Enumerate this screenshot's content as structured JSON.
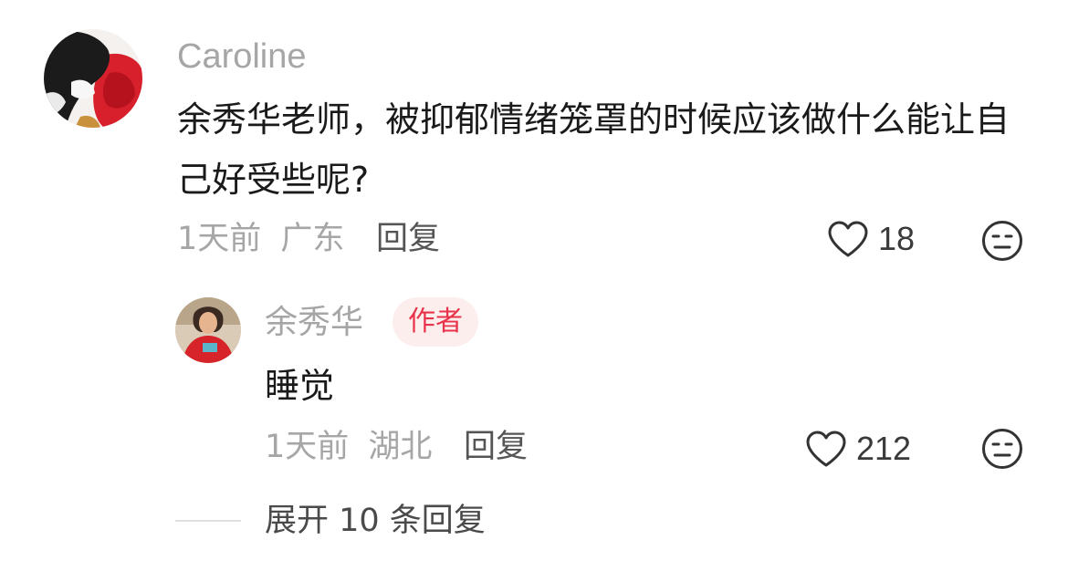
{
  "comment": {
    "author": "Caroline",
    "text": "余秀华老师，被抑郁情绪笼罩的时候应该做什么能让自己好受些呢?",
    "time": "1天前",
    "location": "广东",
    "reply_label": "回复",
    "likes": "18",
    "like_icon": "heart-outline-icon",
    "emoji_icon": "meh-face-icon"
  },
  "reply": {
    "author": "余秀华",
    "badge": "作者",
    "text": "睡觉",
    "time": "1天前",
    "location": "湖北",
    "reply_label": "回复",
    "likes": "212",
    "like_icon": "heart-outline-icon",
    "emoji_icon": "meh-face-icon"
  },
  "expand_label": "展开 10 条回复",
  "colors": {
    "badge_text": "#e8344a",
    "badge_bg": "#fdeeee",
    "muted_text": "#a6a6a6"
  }
}
